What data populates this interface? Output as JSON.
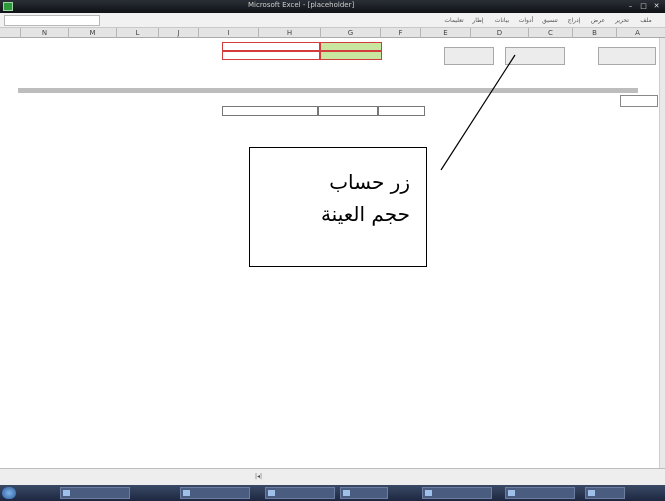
{
  "window": {
    "title": "Microsoft Excel - [placeholder]",
    "min_glyph": "–",
    "max_glyph": "□",
    "close_glyph": "✕"
  },
  "formula_bar": {
    "name_box": "",
    "menu_items": [
      "ملف",
      "تحرير",
      "عرض",
      "إدراج",
      "تنسيق",
      "أدوات",
      "بيانات",
      "إطار",
      "تعليمات"
    ]
  },
  "columns": [
    "N",
    "M",
    "L",
    "J",
    "I",
    "H",
    "G",
    "F",
    "E",
    "D",
    "C",
    "B",
    "A"
  ],
  "buttons": {
    "calc_sample": "",
    "select_sample": "",
    "back": ""
  },
  "labels": {
    "green_row": "",
    "red_row": "",
    "hint": ""
  },
  "data_table": {
    "title": "",
    "headers": [
      "",
      "",
      ""
    ]
  },
  "callout": {
    "line1": "زر حساب",
    "line2": "حجم العينة"
  },
  "status": {
    "left": "",
    "sheet_tabs": ""
  },
  "taskbar": {
    "items": [
      "",
      "",
      "",
      "",
      "",
      "",
      ""
    ],
    "clock": ""
  }
}
